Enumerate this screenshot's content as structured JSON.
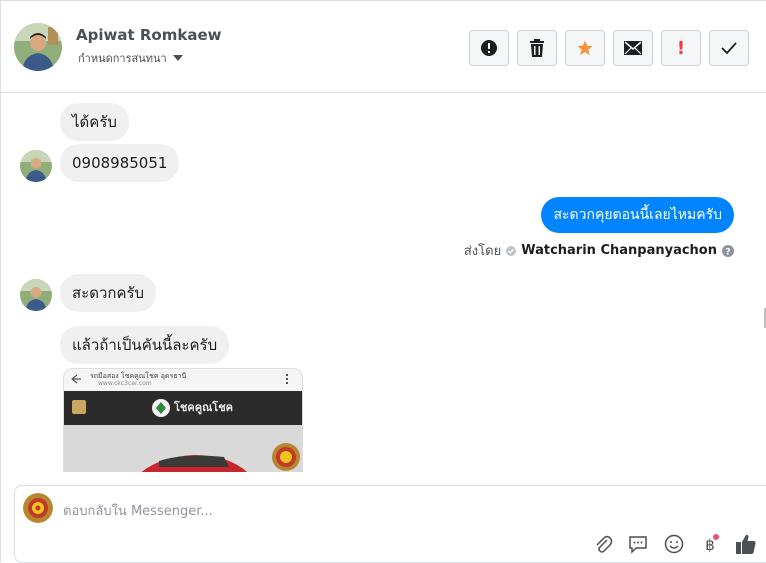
{
  "header": {
    "contact_name": "Apiwat Romkaew",
    "assign_label": "กำหนดการสนทนา",
    "actions": {
      "mark_spam": "mark-spam",
      "delete": "delete",
      "star": "star",
      "mark_unread": "mark-unread",
      "follow_up": "!",
      "done": "done"
    },
    "colors": {
      "star": "#f7923b",
      "follow_up": "#fa383e"
    }
  },
  "messages": [
    {
      "side": "in",
      "text": "ได้ครับ"
    },
    {
      "side": "in",
      "text": "0908985051"
    },
    {
      "side": "out",
      "text": "สะดวกคุยตอนนี้เลยไหมครับ"
    },
    {
      "side": "in",
      "text": "สะดวกครับ"
    },
    {
      "side": "in",
      "text": "แล้วถ้าเป็นคันนี้ละครับ"
    }
  ],
  "sent_by": {
    "prefix": "ส่งโดย",
    "agent": "Watcharin Chanpanyachon"
  },
  "image_preview": {
    "url_line1": "รถมือสอง โชคคูณโชค อุดรธานี",
    "url_line2": "www.ckc3car.com",
    "logo_text": "โชคคูณโชค"
  },
  "composer": {
    "placeholder": "ตอบกลับใน Messenger...",
    "tools": [
      "attachment-icon",
      "saved-reply-icon",
      "emoji-icon",
      "payment-icon",
      "like-icon"
    ]
  },
  "colors": {
    "accent": "#0084ff",
    "incoming_bubble": "#f1f0f0"
  }
}
